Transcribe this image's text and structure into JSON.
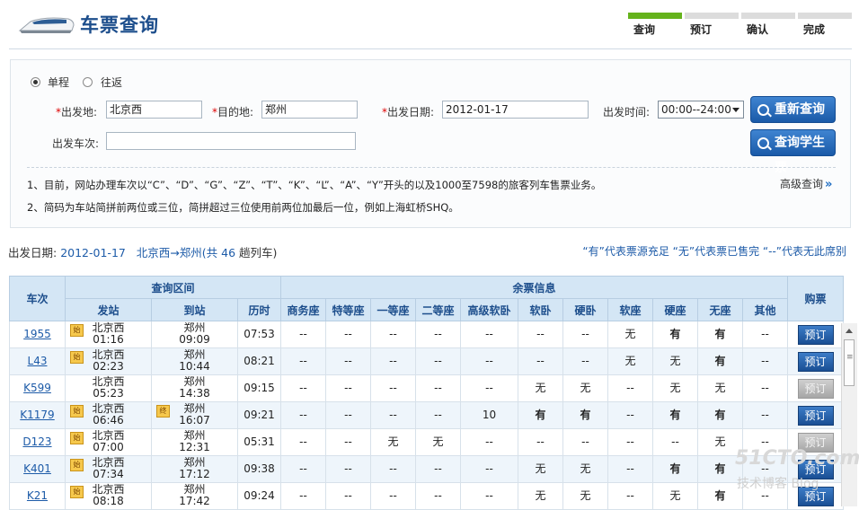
{
  "header": {
    "title": "车票查询"
  },
  "steps": [
    {
      "label": "查询",
      "active": true
    },
    {
      "label": "预订",
      "active": false
    },
    {
      "label": "确认",
      "active": false
    },
    {
      "label": "完成",
      "active": false
    }
  ],
  "query": {
    "trip_oneway": "单程",
    "trip_round": "往返",
    "from_label": "出发地:",
    "from_value": "北京西",
    "to_label": "目的地:",
    "to_value": "郑州",
    "date_label": "出发日期:",
    "date_value": "2012-01-17",
    "time_label": "出发时间:",
    "time_value": "00:00--24:00",
    "train_label": "出发车次:",
    "train_value": "",
    "requery_btn": "重新查询",
    "student_btn": "查询学生票",
    "note1": "1、目前，网站办理车次以“C”、“D”、“G”、“Z”、“T”、“K”、“L”、“A”、“Y”开头的以及1000至7598的旅客列车售票业务。",
    "note2": "2、简码为车站简拼前两位或三位，简拼超过三位使用前两位加最后一位，例如上海虹桥SHQ。",
    "advanced": "高级查询"
  },
  "summary": {
    "date_label": "出发日期:",
    "date": "2012-01-17",
    "route": "北京西→郑州(共",
    "count": "46",
    "count_suffix": "趟列车)"
  },
  "legend": "“有”代表票源充足  “无”代表票已售完  “--”代表无此席别",
  "table": {
    "h_train": "车次",
    "h_range": "查询区间",
    "h_remain": "余票信息",
    "h_book": "购票",
    "h_from": "发站",
    "h_to": "到站",
    "h_duration": "历时",
    "seat_headers": [
      "商务座",
      "特等座",
      "一等座",
      "二等座",
      "高级软卧",
      "软卧",
      "硬卧",
      "软座",
      "硬座",
      "无座",
      "其他"
    ],
    "rows": [
      {
        "train": "1955",
        "from_badge": "始",
        "from": "北京西",
        "dep": "01:16",
        "to_badge": "",
        "to": "郑州",
        "arr": "09:09",
        "dur": "07:53",
        "seats": [
          "--",
          "--",
          "--",
          "--",
          "--",
          "--",
          "--",
          "无",
          "有",
          "有",
          "--"
        ],
        "book": "预订",
        "enabled": true
      },
      {
        "train": "L43",
        "from_badge": "始",
        "from": "北京西",
        "dep": "02:23",
        "to_badge": "",
        "to": "郑州",
        "arr": "10:44",
        "dur": "08:21",
        "seats": [
          "--",
          "--",
          "--",
          "--",
          "--",
          "--",
          "--",
          "无",
          "无",
          "有",
          "--"
        ],
        "book": "预订",
        "enabled": true
      },
      {
        "train": "K599",
        "from_badge": "",
        "from": "北京西",
        "dep": "05:23",
        "to_badge": "",
        "to": "郑州",
        "arr": "14:38",
        "dur": "09:15",
        "seats": [
          "--",
          "--",
          "--",
          "--",
          "--",
          "无",
          "无",
          "--",
          "无",
          "无",
          "--"
        ],
        "book": "预订",
        "enabled": false
      },
      {
        "train": "K1179",
        "from_badge": "始",
        "from": "北京西",
        "dep": "06:46",
        "to_badge": "终",
        "to": "郑州",
        "arr": "16:07",
        "dur": "09:21",
        "seats": [
          "--",
          "--",
          "--",
          "--",
          "10",
          "有",
          "有",
          "--",
          "有",
          "有",
          "--"
        ],
        "book": "预订",
        "enabled": true
      },
      {
        "train": "D123",
        "from_badge": "始",
        "from": "北京西",
        "dep": "07:00",
        "to_badge": "",
        "to": "郑州",
        "arr": "12:31",
        "dur": "05:31",
        "seats": [
          "--",
          "--",
          "无",
          "无",
          "--",
          "--",
          "--",
          "--",
          "--",
          "无",
          "--"
        ],
        "book": "预订",
        "enabled": false
      },
      {
        "train": "K401",
        "from_badge": "始",
        "from": "北京西",
        "dep": "07:34",
        "to_badge": "",
        "to": "郑州",
        "arr": "17:12",
        "dur": "09:38",
        "seats": [
          "--",
          "--",
          "--",
          "--",
          "--",
          "无",
          "无",
          "--",
          "有",
          "有",
          "--"
        ],
        "book": "预订",
        "enabled": true
      },
      {
        "train": "K21",
        "from_badge": "始",
        "from": "北京西",
        "dep": "08:18",
        "to_badge": "",
        "to": "郑州",
        "arr": "17:42",
        "dur": "09:24",
        "seats": [
          "--",
          "--",
          "--",
          "--",
          "--",
          "无",
          "无",
          "--",
          "无",
          "有",
          "--"
        ],
        "book": "预订",
        "enabled": true
      }
    ]
  },
  "watermark": {
    "line1": "51CTO.com",
    "line2": "技术博客 Blog"
  },
  "colors": {
    "brand_blue": "#1d4e8c",
    "step_active": "#65b31c",
    "has_ticket": "#149b14",
    "no_ticket": "#9a9a9a"
  }
}
